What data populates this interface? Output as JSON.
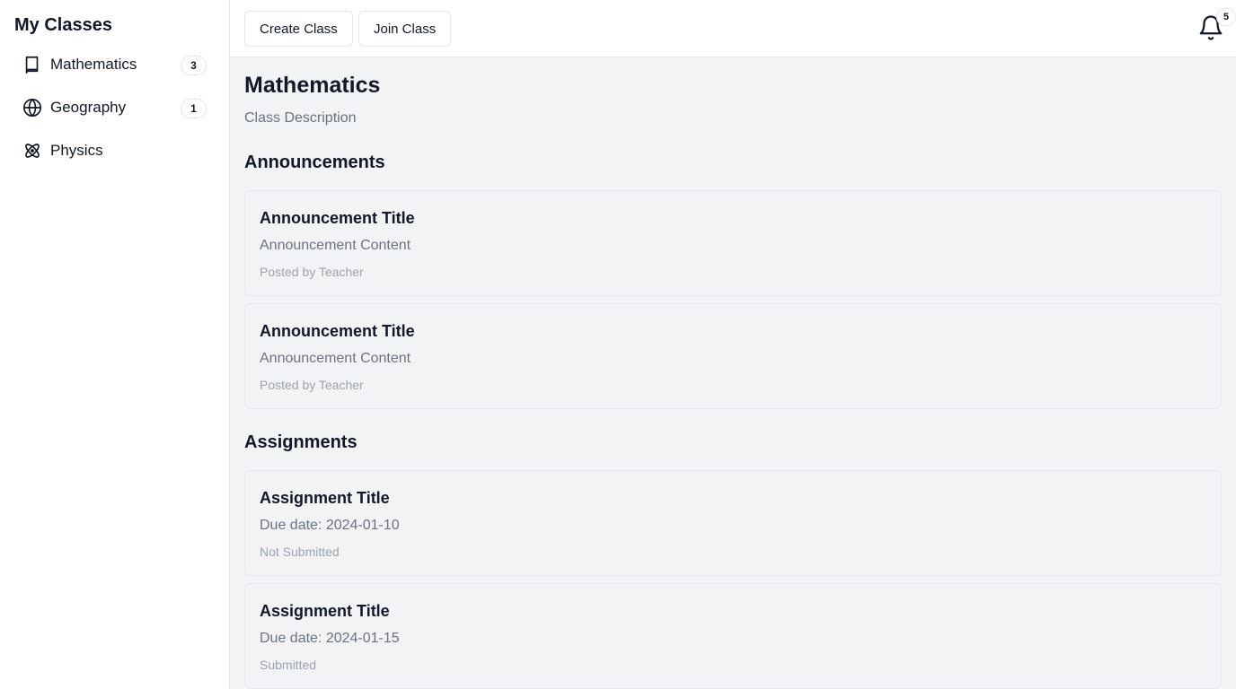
{
  "sidebar": {
    "title": "My Classes",
    "items": [
      {
        "label": "Mathematics",
        "count": "3",
        "icon": "book-icon"
      },
      {
        "label": "Geography",
        "count": "1",
        "icon": "globe-icon"
      },
      {
        "label": "Physics",
        "count": "",
        "icon": "atom-icon"
      }
    ]
  },
  "topbar": {
    "create_label": "Create Class",
    "join_label": "Join Class",
    "notification_icon": "bell-icon",
    "notification_count": "5"
  },
  "main": {
    "class_title": "Mathematics",
    "class_description": "Class Description",
    "announcements_heading": "Announcements",
    "announcements": [
      {
        "title": "Announcement Title",
        "content": "Announcement Content",
        "meta": "Posted by Teacher"
      },
      {
        "title": "Announcement Title",
        "content": "Announcement Content",
        "meta": "Posted by Teacher"
      }
    ],
    "assignments_heading": "Assignments",
    "assignments": [
      {
        "title": "Assignment Title",
        "due": "Due date: 2024-01-10",
        "status": "Not Submitted"
      },
      {
        "title": "Assignment Title",
        "due": "Due date: 2024-01-15",
        "status": "Submitted"
      }
    ]
  },
  "colors": {
    "main_background": "#f2f3f5",
    "border": "#e5e7eb",
    "muted_text": "#6b7280",
    "subtle_text": "#9ca3af"
  }
}
